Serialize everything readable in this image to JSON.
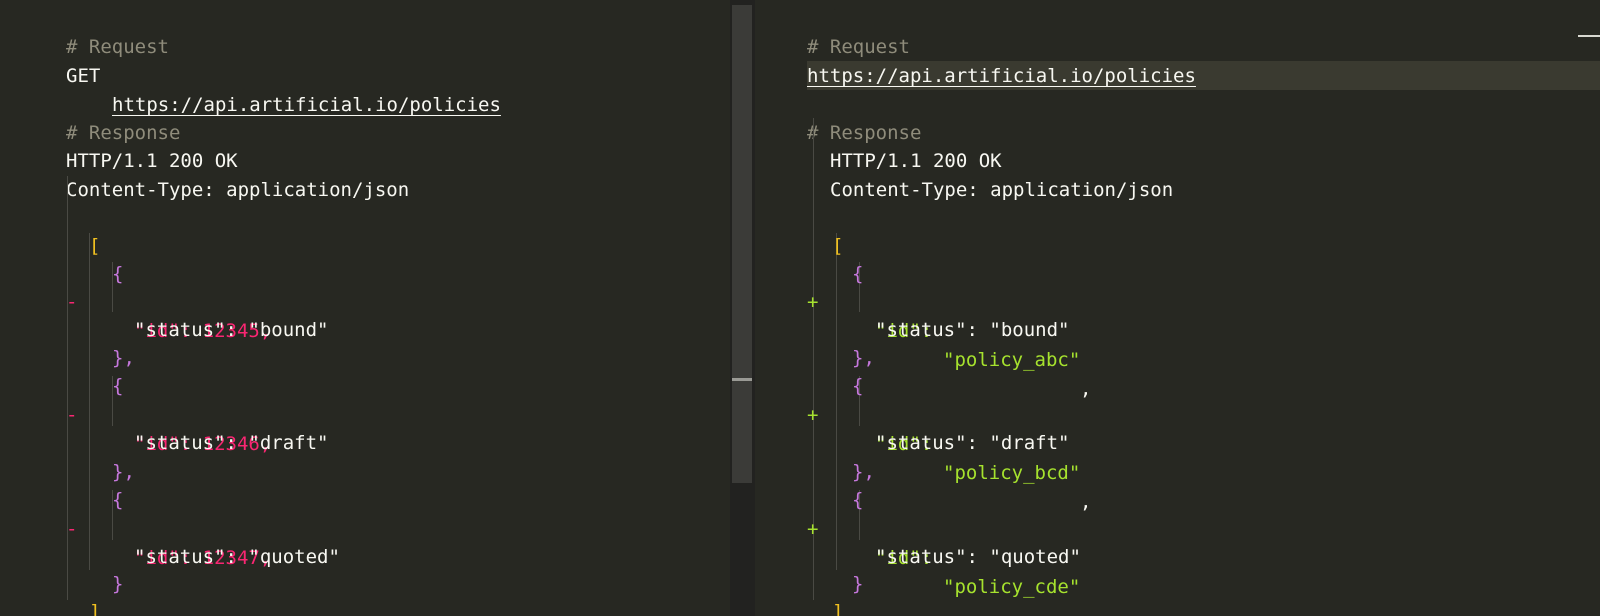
{
  "left": {
    "request_comment": "# Request",
    "method": "GET ",
    "url": "https://api.artificial.io/policies",
    "response_comment": "# Response",
    "status_line": "HTTP/1.1 200 OK",
    "content_type": "Content-Type: application/json",
    "open_bracket": "[",
    "close_bracket": "]",
    "diff_marker": "-",
    "records": [
      {
        "id_line": "\"id\": 12345,",
        "status_line": "\"status\": \"bound\"",
        "close": "},"
      },
      {
        "id_line": "\"id\": 12346,",
        "status_line": "\"status\": \"draft\"",
        "close": "},"
      },
      {
        "id_line": "\"id\": 12347,",
        "status_line": "\"status\": \"quoted\"",
        "close": "}"
      }
    ],
    "open_brace": "{"
  },
  "right": {
    "request_comment": "# Request",
    "url": "https://api.artificial.io/policies",
    "response_comment": "# Response",
    "status_line": "HTTP/1.1 200 OK",
    "content_type": "Content-Type: application/json",
    "open_bracket": "[",
    "close_bracket": "]",
    "diff_marker": "+",
    "records": [
      {
        "id_key": "\"id\": ",
        "id_value": "\"policy_abc\"",
        "comma": ",",
        "status_line": "\"status\": \"bound\"",
        "close": "},"
      },
      {
        "id_key": "\"id\": ",
        "id_value": "\"policy_bcd\"",
        "comma": ",",
        "status_line": "\"status\": \"draft\"",
        "close": "},"
      },
      {
        "id_key": "\"id\": ",
        "id_value": "\"policy_cde\"",
        "comma": ",",
        "status_line": "\"status\": \"quoted\"",
        "close": "}"
      }
    ],
    "open_brace": "{"
  },
  "colors": {
    "background": "#272822",
    "comment": "#8f8c7b",
    "removed": "#f92672",
    "added": "#a6e22e",
    "bracket": "#f0c020",
    "brace": "#c678dd"
  }
}
